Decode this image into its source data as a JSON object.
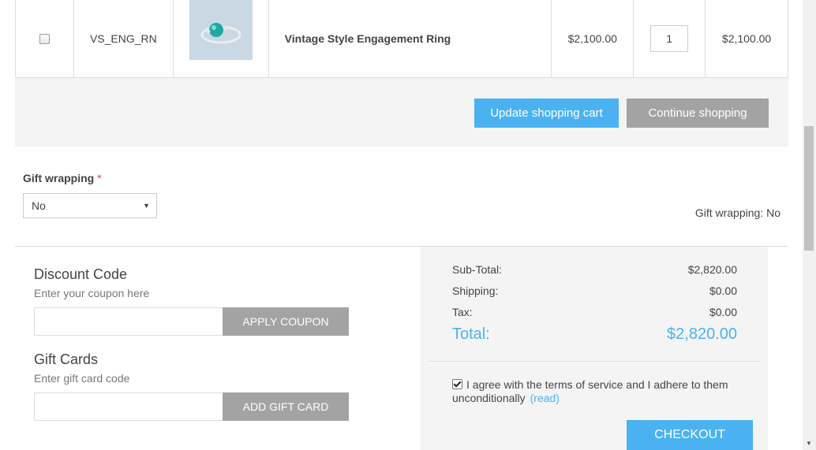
{
  "cart": {
    "row": {
      "sku": "VS_ENG_RN",
      "name": "Vintage Style Engagement Ring",
      "unit_price": "$2,100.00",
      "quantity": "1",
      "subtotal": "$2,100.00"
    },
    "update_label": "Update shopping cart",
    "continue_label": "Continue shopping"
  },
  "gift_wrapping": {
    "label": "Gift wrapping",
    "required_mark": "*",
    "selected": "No",
    "info": "Gift wrapping: No"
  },
  "discount": {
    "title": "Discount Code",
    "hint": "Enter your coupon here",
    "value": "",
    "button": "APPLY COUPON"
  },
  "giftcard": {
    "title": "Gift Cards",
    "hint": "Enter gift card code",
    "value": "",
    "button": "ADD GIFT CARD"
  },
  "totals": {
    "subtotal_label": "Sub-Total:",
    "subtotal_value": "$2,820.00",
    "shipping_label": "Shipping:",
    "shipping_value": "$0.00",
    "tax_label": "Tax:",
    "tax_value": "$0.00",
    "total_label": "Total:",
    "total_value": "$2,820.00"
  },
  "terms": {
    "text": "I agree with the terms of service and I adhere to them unconditionally",
    "read_link": "(read)",
    "checked": true
  },
  "checkout_label": "CHECKOUT",
  "colors": {
    "accent": "#4ab2f1",
    "gray_button": "#a3a3a3",
    "panel_bg": "#f4f4f4",
    "required": "#e4434b"
  }
}
